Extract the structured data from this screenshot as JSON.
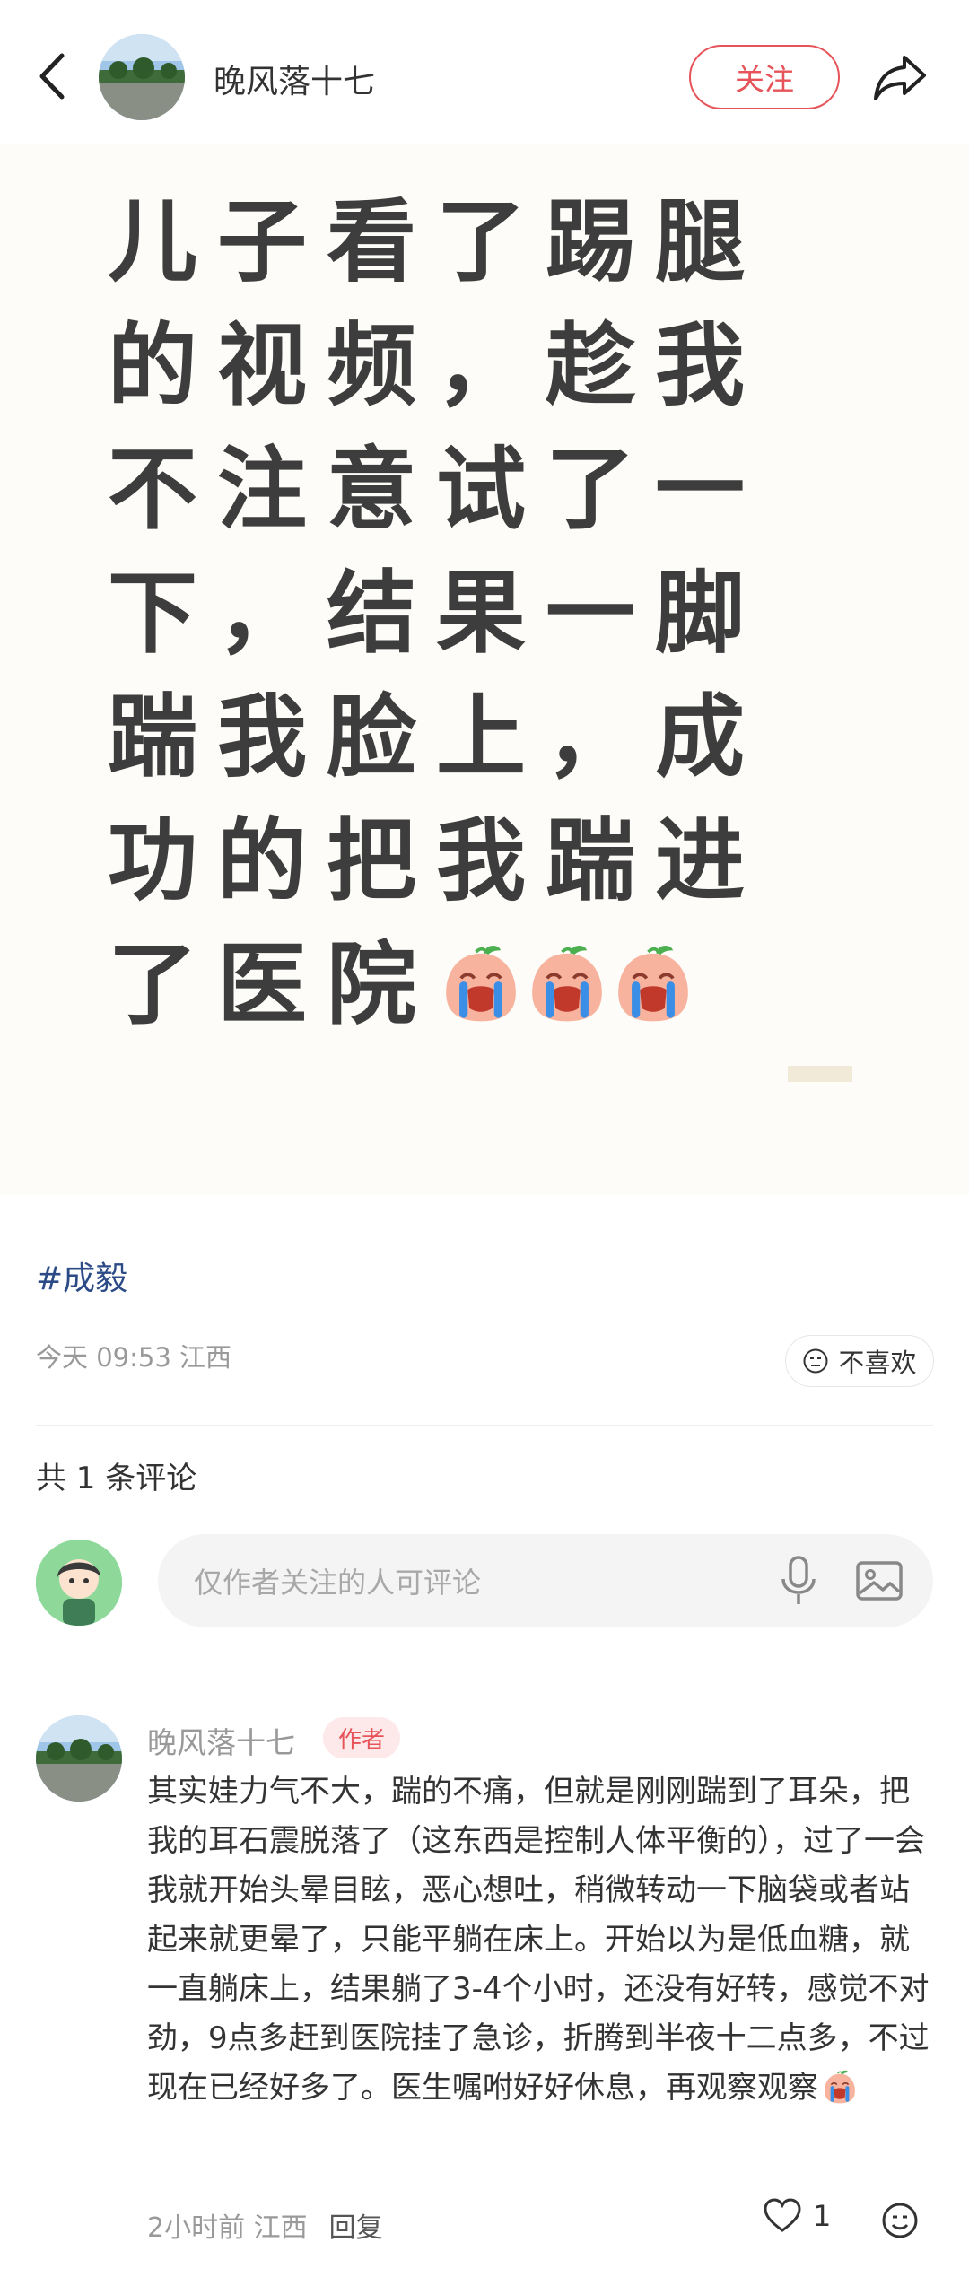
{
  "header": {
    "author_name": "晚风落十七",
    "follow_label": "关注",
    "back_icon": "chevron-left-icon",
    "share_icon": "share-arrow-icon"
  },
  "post": {
    "text": "儿子看了踢腿的视频，趁我不注意试了一下，结果一脚踹我脸上，成功的把我踹进了医院",
    "emoji_name": "crying-face-emoji",
    "emoji_count": 3,
    "topic": "#成毅",
    "time": "今天 09:53",
    "location": "江西",
    "dislike_label": "不喜欢"
  },
  "comments_section": {
    "count_label": "共 1 条评论",
    "input_placeholder": "仅作者关注的人可评论"
  },
  "comments": [
    {
      "name": "晚风落十七",
      "badge": "作者",
      "text": "其实娃力气不大，踹的不痛，但就是刚刚踹到了耳朵，把我的耳石震脱落了（这东西是控制人体平衡的），过了一会我就开始头晕目眩，恶心想吐，稍微转动一下脑袋或者站起来就更晕了，只能平躺在床上。开始以为是低血糖，就一直躺床上，结果躺了3-4个小时，还没有好转，感觉不对劲，9点多赶到医院挂了急诊，折腾到半夜十二点多，不过现在已经好多了。医生嘱咐好好休息，再观察观察",
      "time": "2小时前",
      "location": "江西",
      "reply_label": "回复",
      "likes": "1"
    }
  ],
  "colors": {
    "accent": "#e6545a",
    "topic": "#2b4a86",
    "card_bg": "#fdfcf8"
  }
}
